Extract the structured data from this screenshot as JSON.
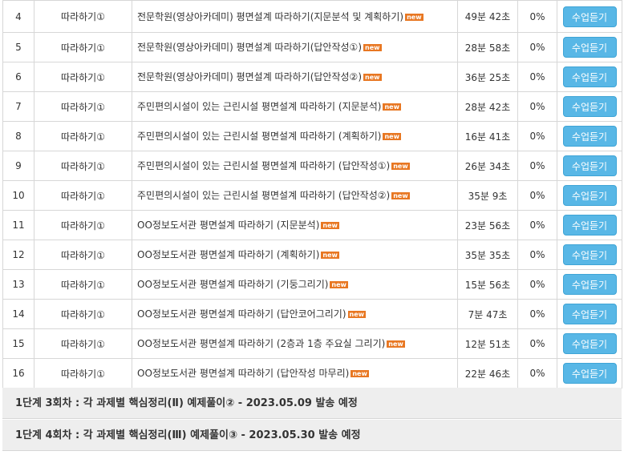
{
  "rows": [
    {
      "no": "4",
      "type": "따라하기①",
      "title": "전문학원(영상아카데미) 평면설계 따라하기(지문분석 및 계획하기)",
      "badge": "new",
      "duration": "49분 42초",
      "progress": "0%",
      "button": "수업듣기"
    },
    {
      "no": "5",
      "type": "따라하기①",
      "title": "전문학원(영상아카데미) 평면설계 따라하기(답안작성①)",
      "badge": "new",
      "duration": "28분 58초",
      "progress": "0%",
      "button": "수업듣기"
    },
    {
      "no": "6",
      "type": "따라하기①",
      "title": "전문학원(영상아카데미) 평면설계 따라하기(답안작성②)",
      "badge": "new",
      "duration": "36분 25초",
      "progress": "0%",
      "button": "수업듣기"
    },
    {
      "no": "7",
      "type": "따라하기①",
      "title": "주민편의시설이 있는 근린시설 평면설계 따라하기 (지문분석)",
      "badge": "new",
      "duration": "28분 42초",
      "progress": "0%",
      "button": "수업듣기"
    },
    {
      "no": "8",
      "type": "따라하기①",
      "title": "주민편의시설이 있는 근린시설 평면설계 따라하기 (계획하기)",
      "badge": "new",
      "duration": "16분 41초",
      "progress": "0%",
      "button": "수업듣기"
    },
    {
      "no": "9",
      "type": "따라하기①",
      "title": "주민편의시설이 있는 근린시설 평면설계 따라하기 (답안작성①)",
      "badge": "new",
      "duration": "26분 34초",
      "progress": "0%",
      "button": "수업듣기"
    },
    {
      "no": "10",
      "type": "따라하기①",
      "title": "주민편의시설이 있는 근린시설 평면설계 따라하기 (답안작성②)",
      "badge": "new",
      "duration": "35분 9초",
      "progress": "0%",
      "button": "수업듣기"
    },
    {
      "no": "11",
      "type": "따라하기①",
      "title": "OO정보도서관 평면설계 따라하기 (지문분석)",
      "badge": "new",
      "duration": "23분 56초",
      "progress": "0%",
      "button": "수업듣기"
    },
    {
      "no": "12",
      "type": "따라하기①",
      "title": "OO정보도서관 평면설계 따라하기 (계획하기)",
      "badge": "new",
      "duration": "35분 35초",
      "progress": "0%",
      "button": "수업듣기"
    },
    {
      "no": "13",
      "type": "따라하기①",
      "title": "OO정보도서관 평면설계 따라하기 (기둥그리기)",
      "badge": "new",
      "duration": "15분 56초",
      "progress": "0%",
      "button": "수업듣기"
    },
    {
      "no": "14",
      "type": "따라하기①",
      "title": "OO정보도서관 평면설계 따라하기 (답안코어그리기)",
      "badge": "new",
      "duration": "7분 47초",
      "progress": "0%",
      "button": "수업듣기"
    },
    {
      "no": "15",
      "type": "따라하기①",
      "title": "OO정보도서관 평면설계 따라하기 (2층과 1층 주요실 그리기)",
      "badge": "new",
      "duration": "12분 51초",
      "progress": "0%",
      "button": "수업듣기"
    },
    {
      "no": "16",
      "type": "따라하기①",
      "title": "OO정보도서관 평면설계 따라하기 (답안작성 마무리)",
      "badge": "new",
      "duration": "22분 46초",
      "progress": "0%",
      "button": "수업듣기"
    }
  ],
  "stages": {
    "stage3": "1단계 3회차 : 각 과제별 핵심정리(Ⅱ) 예제풀이② - 2023.05.09 발송 예정",
    "stage4": "1단계 4회차 : 각 과제별 핵심정리(Ⅲ) 예제풀이③ - 2023.05.30 발송 예정"
  },
  "colors": {
    "button": "#58b7e6",
    "new_badge": "#e87722",
    "stage_bg": "#eeeeee"
  }
}
